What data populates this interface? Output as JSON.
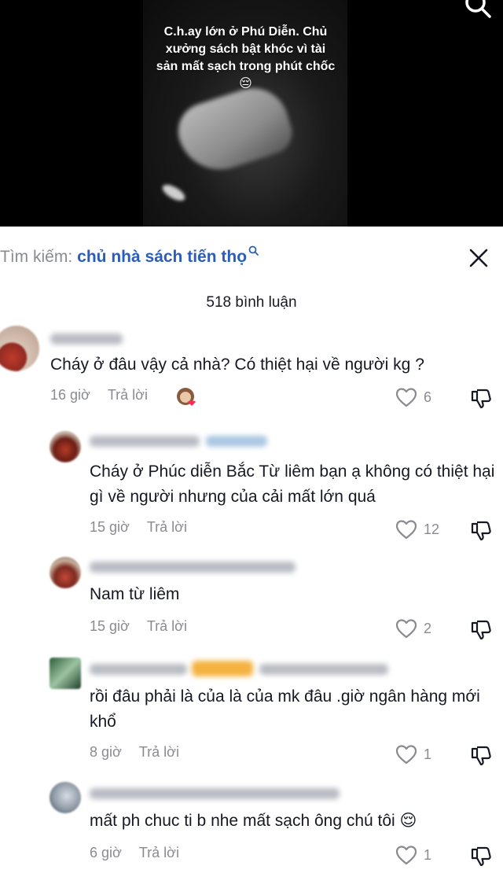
{
  "video": {
    "caption": "C.h.ay lớn ở Phú Diễn. Chủ xưởng sách bật khóc vì tài sản mất sạch trong phút chốc 😔"
  },
  "search": {
    "prefix": "Tìm kiếm:",
    "query": "chủ nhà sách tiến thọ"
  },
  "comment_count": "518 bình luận",
  "comments": [
    {
      "text": "Cháy ở đâu vậy cả nhà? Có thiệt hại về người kg ?",
      "time": "16 giờ",
      "reply": "Trả lời",
      "likes": "6"
    },
    {
      "text": "Cháy ở Phúc diễn Bắc Từ liêm bạn ạ không có thiệt hại gì về người nhưng của cải mất lớn quá",
      "time": "15 giờ",
      "reply": "Trả lời",
      "likes": "12"
    },
    {
      "text": "Nam từ liêm",
      "time": "15 giờ",
      "reply": "Trả lời",
      "likes": "2"
    },
    {
      "text": "rồi đâu phải là của là của mk đâu .giờ ngân hàng mới khổ",
      "time": "8 giờ",
      "reply": "Trả lời",
      "likes": "1"
    },
    {
      "text": "mất ph chuc ti b nhe mất sạch ông chú tôi 😌",
      "time": "6 giờ",
      "reply": "Trả lời",
      "likes": "1"
    }
  ],
  "colors": {
    "link": "#2b5db9",
    "muted": "#8a8b91",
    "text": "#161823"
  },
  "icons": [
    "search-icon",
    "close-icon",
    "heart-icon",
    "dislike-icon"
  ]
}
